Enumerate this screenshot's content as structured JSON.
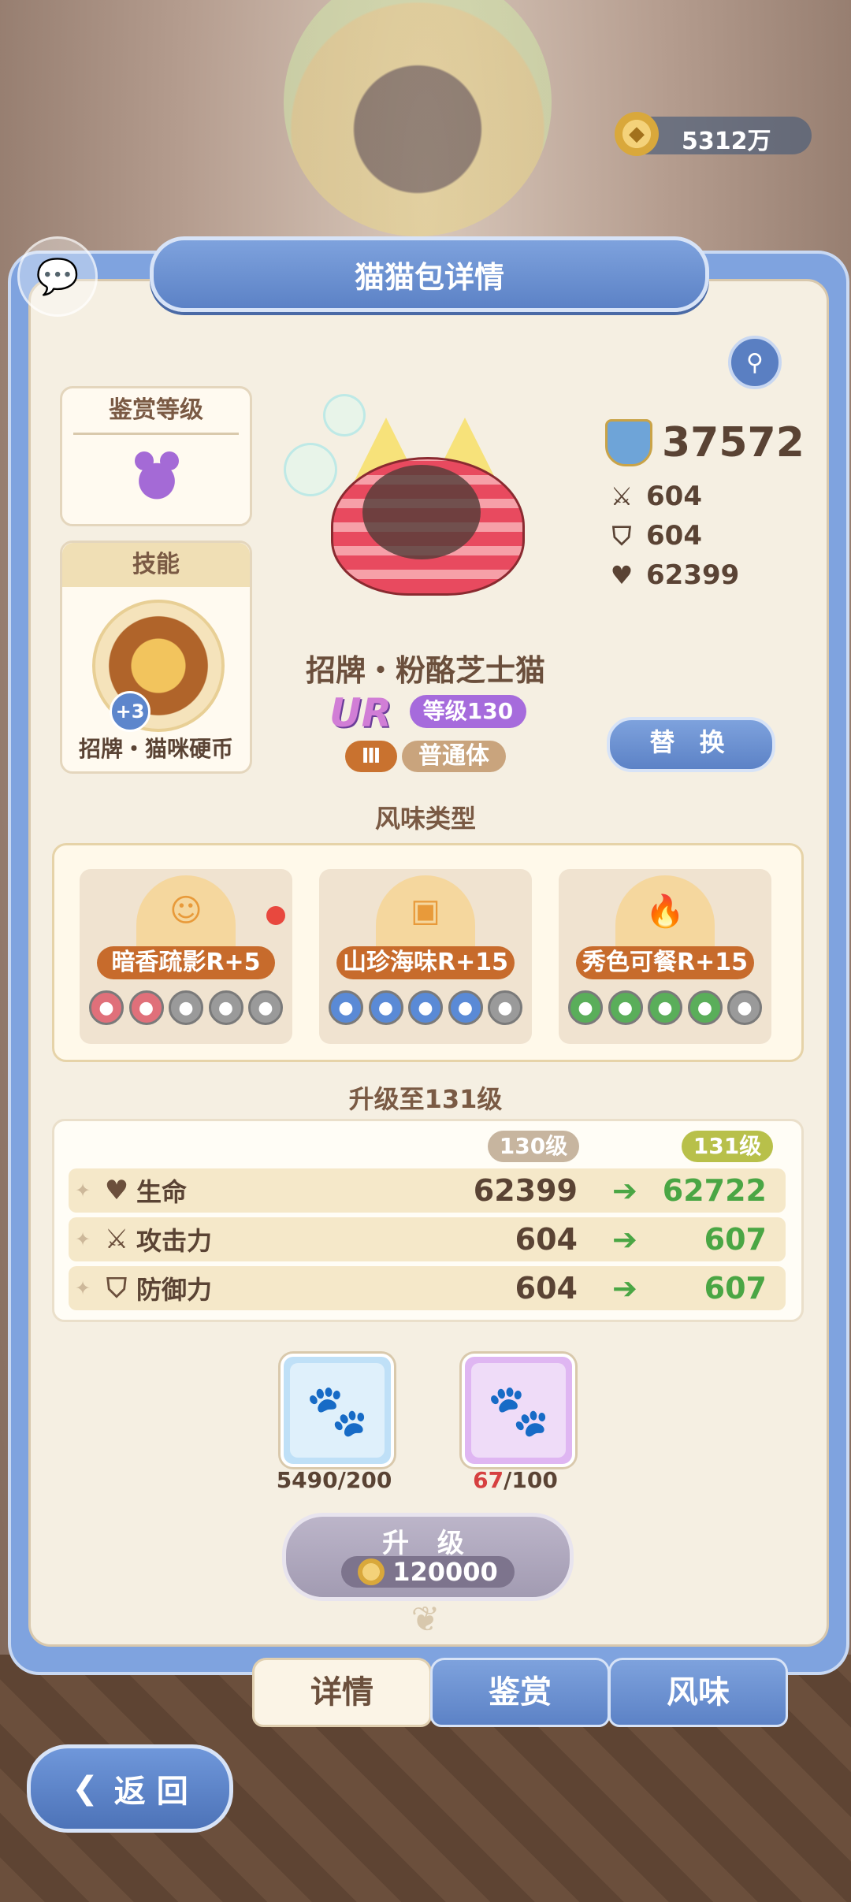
{
  "currency": {
    "amount": "5312万"
  },
  "panel": {
    "title": "猫猫包详情"
  },
  "appreciation": {
    "title": "鉴赏等级"
  },
  "skill": {
    "title": "技能",
    "bonus": "+3",
    "name": "招牌・猫咪硬币"
  },
  "stats": {
    "power": "37572",
    "attack": "604",
    "defense": "604",
    "health": "62399"
  },
  "cat": {
    "name": "招牌・粉酪芝士猫",
    "rarity": "UR",
    "level": "等级130",
    "tier": "Ⅲ",
    "body_type": "普通体"
  },
  "replace_label": "替 换",
  "flavor": {
    "title": "风味类型",
    "items": [
      {
        "label": "暗香疏影R+5",
        "filled": 2,
        "total": 5,
        "color": "#e0707a"
      },
      {
        "label": "山珍海味R+15",
        "filled": 4,
        "total": 5,
        "color": "#5a8ad6"
      },
      {
        "label": "秀色可餐R+15",
        "filled": 4,
        "total": 5,
        "color": "#5aae5a"
      }
    ]
  },
  "upgrade": {
    "title": "升级至131级",
    "current_level": "130级",
    "next_level": "131级",
    "rows": [
      {
        "label": "生命",
        "current": "62399",
        "next": "62722",
        "icon": "heart-icon"
      },
      {
        "label": "攻击力",
        "current": "604",
        "next": "607",
        "icon": "swords-icon"
      },
      {
        "label": "防御力",
        "current": "604",
        "next": "607",
        "icon": "shield-icon"
      }
    ]
  },
  "materials": [
    {
      "name": "paw-jelly",
      "have": "5490",
      "need": "/200"
    },
    {
      "name": "golden-paw-toast",
      "have": "67",
      "need": "/100"
    }
  ],
  "upgrade_button": {
    "label": "升 级",
    "cost": "120000"
  },
  "tabs": [
    {
      "label": "详情"
    },
    {
      "label": "鉴赏"
    },
    {
      "label": "风味"
    }
  ],
  "back_label": "返 回"
}
